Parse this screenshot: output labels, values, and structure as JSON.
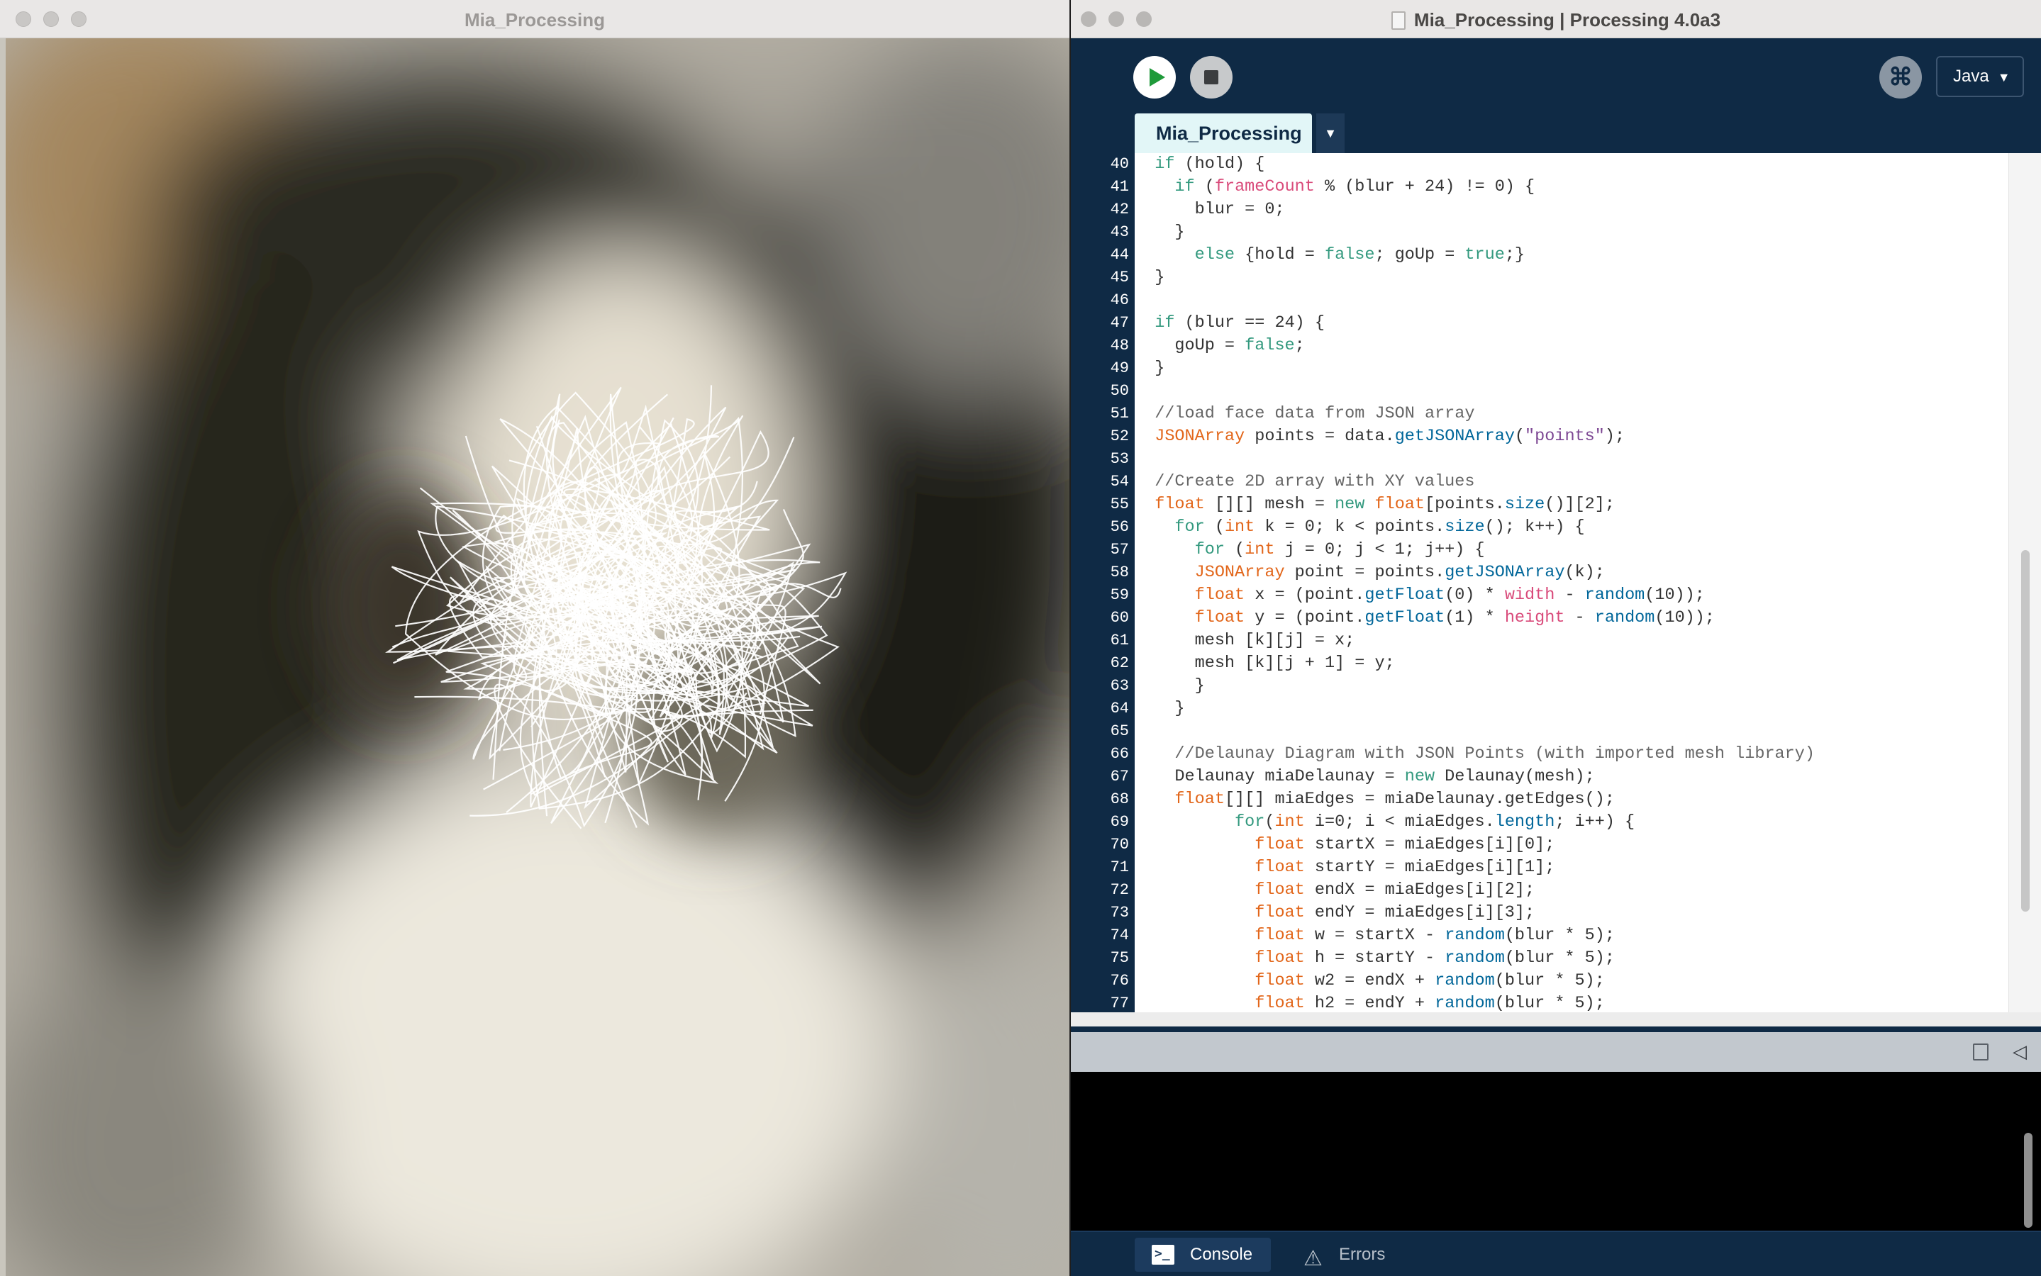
{
  "sketch_window": {
    "title": "Mia_Processing"
  },
  "ide_window": {
    "title": "Mia_Processing | Processing 4.0a3"
  },
  "toolbar": {
    "run_icon": "play-icon",
    "stop_icon": "stop-icon",
    "debug_icon": "debugger-icon",
    "debug_glyph": "⌘",
    "mode": "Java",
    "mode_chevron": "▼"
  },
  "tabs": {
    "active": "Mia_Processing",
    "menu_glyph": "▼"
  },
  "editor": {
    "first_line_number": 40,
    "line_numbers": [
      "40",
      "41",
      "42",
      "43",
      "44",
      "45",
      "46",
      "47",
      "48",
      "49",
      "50",
      "51",
      "52",
      "53",
      "54",
      "55",
      "56",
      "57",
      "58",
      "59",
      "60",
      "61",
      "62",
      "63",
      "64",
      "65",
      "66",
      "67",
      "68",
      "69",
      "70",
      "71",
      "72",
      "73",
      "74",
      "75",
      "76",
      "77"
    ],
    "lines": [
      [
        [
          "  ",
          ""
        ],
        [
          "if",
          "kw"
        ],
        [
          " (hold) {",
          ""
        ]
      ],
      [
        [
          "    ",
          ""
        ],
        [
          "if",
          "kw"
        ],
        [
          " (",
          ""
        ],
        [
          "frameCount",
          "vr"
        ],
        [
          " % (blur + 24) != 0) {",
          ""
        ]
      ],
      [
        [
          "      blur = 0;",
          ""
        ]
      ],
      [
        [
          "    }",
          ""
        ]
      ],
      [
        [
          "      ",
          ""
        ],
        [
          "else",
          "kw"
        ],
        [
          " {hold = ",
          ""
        ],
        [
          "false",
          "kw"
        ],
        [
          "; goUp = ",
          ""
        ],
        [
          "true",
          "kw"
        ],
        [
          ";}",
          ""
        ]
      ],
      [
        [
          "  }",
          ""
        ]
      ],
      [
        [
          "",
          ""
        ]
      ],
      [
        [
          "  ",
          ""
        ],
        [
          "if",
          "kw"
        ],
        [
          " (blur == 24) {",
          ""
        ]
      ],
      [
        [
          "    goUp = ",
          ""
        ],
        [
          "false",
          "kw"
        ],
        [
          ";",
          ""
        ]
      ],
      [
        [
          "  }",
          ""
        ]
      ],
      [
        [
          "",
          ""
        ]
      ],
      [
        [
          "  //load face data from JSON array",
          "cm"
        ]
      ],
      [
        [
          "  ",
          ""
        ],
        [
          "JSONArray",
          "ty"
        ],
        [
          " points = data.",
          ""
        ],
        [
          "getJSONArray",
          "fn"
        ],
        [
          "(",
          ""
        ],
        [
          "\"points\"",
          "st"
        ],
        [
          ");",
          ""
        ]
      ],
      [
        [
          "",
          ""
        ]
      ],
      [
        [
          "  //Create 2D array with XY values",
          "cm"
        ]
      ],
      [
        [
          "  ",
          ""
        ],
        [
          "float",
          "ty"
        ],
        [
          " [][] mesh = ",
          ""
        ],
        [
          "new",
          "kw"
        ],
        [
          " ",
          ""
        ],
        [
          "float",
          "ty"
        ],
        [
          "[points.",
          ""
        ],
        [
          "size",
          "fn"
        ],
        [
          "()][2];",
          ""
        ]
      ],
      [
        [
          "    ",
          ""
        ],
        [
          "for",
          "kw"
        ],
        [
          " (",
          ""
        ],
        [
          "int",
          "ty"
        ],
        [
          " k = 0; k < points.",
          ""
        ],
        [
          "size",
          "fn"
        ],
        [
          "(); k++) {",
          ""
        ]
      ],
      [
        [
          "      ",
          ""
        ],
        [
          "for",
          "kw"
        ],
        [
          " (",
          ""
        ],
        [
          "int",
          "ty"
        ],
        [
          " j = 0; j < 1; j++) {",
          ""
        ]
      ],
      [
        [
          "      ",
          ""
        ],
        [
          "JSONArray",
          "ty"
        ],
        [
          " point = points.",
          ""
        ],
        [
          "getJSONArray",
          "fn"
        ],
        [
          "(k);",
          ""
        ]
      ],
      [
        [
          "      ",
          ""
        ],
        [
          "float",
          "ty"
        ],
        [
          " x = (point.",
          ""
        ],
        [
          "getFloat",
          "fn"
        ],
        [
          "(0) * ",
          ""
        ],
        [
          "width",
          "vr"
        ],
        [
          " - ",
          ""
        ],
        [
          "random",
          "fn"
        ],
        [
          "(10));",
          ""
        ]
      ],
      [
        [
          "      ",
          ""
        ],
        [
          "float",
          "ty"
        ],
        [
          " y = (point.",
          ""
        ],
        [
          "getFloat",
          "fn"
        ],
        [
          "(1) * ",
          ""
        ],
        [
          "height",
          "vr"
        ],
        [
          " - ",
          ""
        ],
        [
          "random",
          "fn"
        ],
        [
          "(10));",
          ""
        ]
      ],
      [
        [
          "      mesh [k][j] = x;",
          ""
        ]
      ],
      [
        [
          "      mesh [k][j + 1] = y;",
          ""
        ]
      ],
      [
        [
          "      }",
          ""
        ]
      ],
      [
        [
          "    }",
          ""
        ]
      ],
      [
        [
          "",
          ""
        ]
      ],
      [
        [
          "    //Delaunay Diagram with JSON Points (with imported mesh library)",
          "cm"
        ]
      ],
      [
        [
          "    Delaunay miaDelaunay = ",
          ""
        ],
        [
          "new",
          "kw"
        ],
        [
          " Delaunay(mesh);",
          ""
        ]
      ],
      [
        [
          "    ",
          ""
        ],
        [
          "float",
          "ty"
        ],
        [
          "[][] miaEdges = miaDelaunay.getEdges();",
          ""
        ]
      ],
      [
        [
          "          ",
          ""
        ],
        [
          "for",
          "kw"
        ],
        [
          "(",
          ""
        ],
        [
          "int",
          "ty"
        ],
        [
          " i=0; i < miaEdges.",
          ""
        ],
        [
          "length",
          "fn"
        ],
        [
          "; i++) {",
          ""
        ]
      ],
      [
        [
          "            ",
          ""
        ],
        [
          "float",
          "ty"
        ],
        [
          " startX = miaEdges[i][0];",
          ""
        ]
      ],
      [
        [
          "            ",
          ""
        ],
        [
          "float",
          "ty"
        ],
        [
          " startY = miaEdges[i][1];",
          ""
        ]
      ],
      [
        [
          "            ",
          ""
        ],
        [
          "float",
          "ty"
        ],
        [
          " endX = miaEdges[i][2];",
          ""
        ]
      ],
      [
        [
          "            ",
          ""
        ],
        [
          "float",
          "ty"
        ],
        [
          " endY = miaEdges[i][3];",
          ""
        ]
      ],
      [
        [
          "            ",
          ""
        ],
        [
          "float",
          "ty"
        ],
        [
          " w = startX - ",
          ""
        ],
        [
          "random",
          "fn"
        ],
        [
          "(blur * 5);",
          ""
        ]
      ],
      [
        [
          "            ",
          ""
        ],
        [
          "float",
          "ty"
        ],
        [
          " h = startY - ",
          ""
        ],
        [
          "random",
          "fn"
        ],
        [
          "(blur * 5);",
          ""
        ]
      ],
      [
        [
          "            ",
          ""
        ],
        [
          "float",
          "ty"
        ],
        [
          " w2 = endX + ",
          ""
        ],
        [
          "random",
          "fn"
        ],
        [
          "(blur * 5);",
          ""
        ]
      ],
      [
        [
          "            ",
          ""
        ],
        [
          "float",
          "ty"
        ],
        [
          " h2 = endY + ",
          ""
        ],
        [
          "random",
          "fn"
        ],
        [
          "(blur * 5);",
          ""
        ]
      ]
    ]
  },
  "console": {
    "copy_icon": "copy-icon",
    "collapse_icon": "collapse-icon",
    "collapse_glyph": "◁"
  },
  "bottom_tabs": {
    "console_label": "Console",
    "errors_label": "Errors",
    "errors_glyph": "⚠"
  },
  "colors": {
    "ide_background": "#0f2a45",
    "run_green": "#1f9a3a",
    "keyword": "#33997e",
    "type": "#e2661a",
    "function": "#006699",
    "builtin_var": "#d94a7a",
    "string": "#7d4793",
    "comment": "#666666"
  }
}
